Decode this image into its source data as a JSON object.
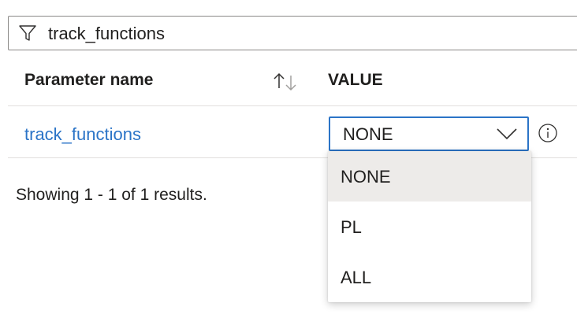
{
  "filter": {
    "value": "track_functions",
    "icon": "filter-icon"
  },
  "table": {
    "columns": {
      "param_name": "Parameter name",
      "value": "VALUE"
    },
    "rows": [
      {
        "name": "track_functions",
        "value": "NONE"
      }
    ]
  },
  "dropdown": {
    "selected": "NONE",
    "options": [
      "NONE",
      "PL",
      "ALL"
    ]
  },
  "footer": {
    "results": "Showing 1 - 1 of 1 results."
  },
  "colors": {
    "link": "#2b74c7",
    "selected_option_bg": "#edebe9",
    "border": "#8a8886"
  }
}
